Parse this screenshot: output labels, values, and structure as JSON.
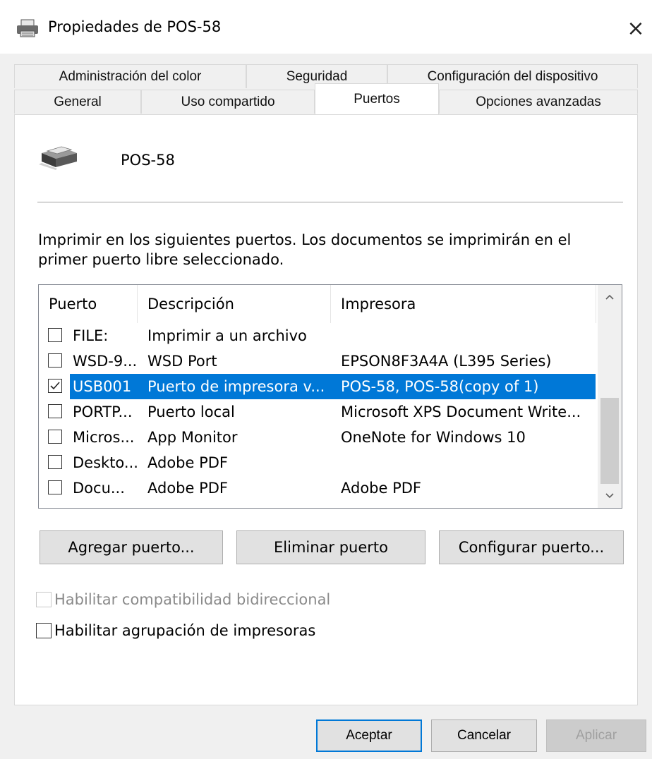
{
  "window": {
    "title": "Propiedades de POS-58",
    "close_glyph": "×"
  },
  "tabs": {
    "row1": [
      "Administración del color",
      "Seguridad",
      "Configuración del dispositivo"
    ],
    "row2": [
      "General",
      "Uso compartido",
      "Puertos",
      "Opciones avanzadas"
    ],
    "active": "Puertos"
  },
  "printer": {
    "name": "POS-58",
    "icon": "printer-icon"
  },
  "description": "Imprimir en los siguientes puertos. Los documentos se imprimirán en el primer puerto libre seleccionado.",
  "ports_table": {
    "headers": [
      "Puerto",
      "Descripción",
      "Impresora"
    ],
    "rows": [
      {
        "checked": false,
        "port": "FILE:",
        "description": "Imprimir a un archivo",
        "printer": ""
      },
      {
        "checked": false,
        "port": "WSD-9...",
        "description": "WSD Port",
        "printer": "EPSON8F3A4A (L395 Series)"
      },
      {
        "checked": true,
        "port": "USB001",
        "description": "Puerto de impresora v...",
        "printer": "POS-58, POS-58(copy of 1)",
        "selected": true
      },
      {
        "checked": false,
        "port": "PORTP...",
        "description": "Puerto local",
        "printer": "Microsoft XPS Document Write..."
      },
      {
        "checked": false,
        "port": "Micros...",
        "description": "App Monitor",
        "printer": "OneNote for Windows 10"
      },
      {
        "checked": false,
        "port": "Deskto...",
        "description": "Adobe PDF",
        "printer": ""
      },
      {
        "checked": false,
        "port": "Docu...",
        "description": "Adobe PDF",
        "printer": "Adobe PDF"
      }
    ]
  },
  "port_buttons": {
    "add": "Agregar puerto...",
    "delete": "Eliminar puerto",
    "configure": "Configurar puerto..."
  },
  "options": {
    "bidirectional": {
      "label": "Habilitar compatibilidad bidireccional",
      "checked": false,
      "enabled": false
    },
    "pooling": {
      "label": "Habilitar agrupación de impresoras",
      "checked": false,
      "enabled": true
    }
  },
  "footer": {
    "ok": "Aceptar",
    "cancel": "Cancelar",
    "apply": "Aplicar"
  },
  "colors": {
    "selection": "#0078d7",
    "panel": "#ffffff",
    "window_bg": "#f0f0f0"
  }
}
